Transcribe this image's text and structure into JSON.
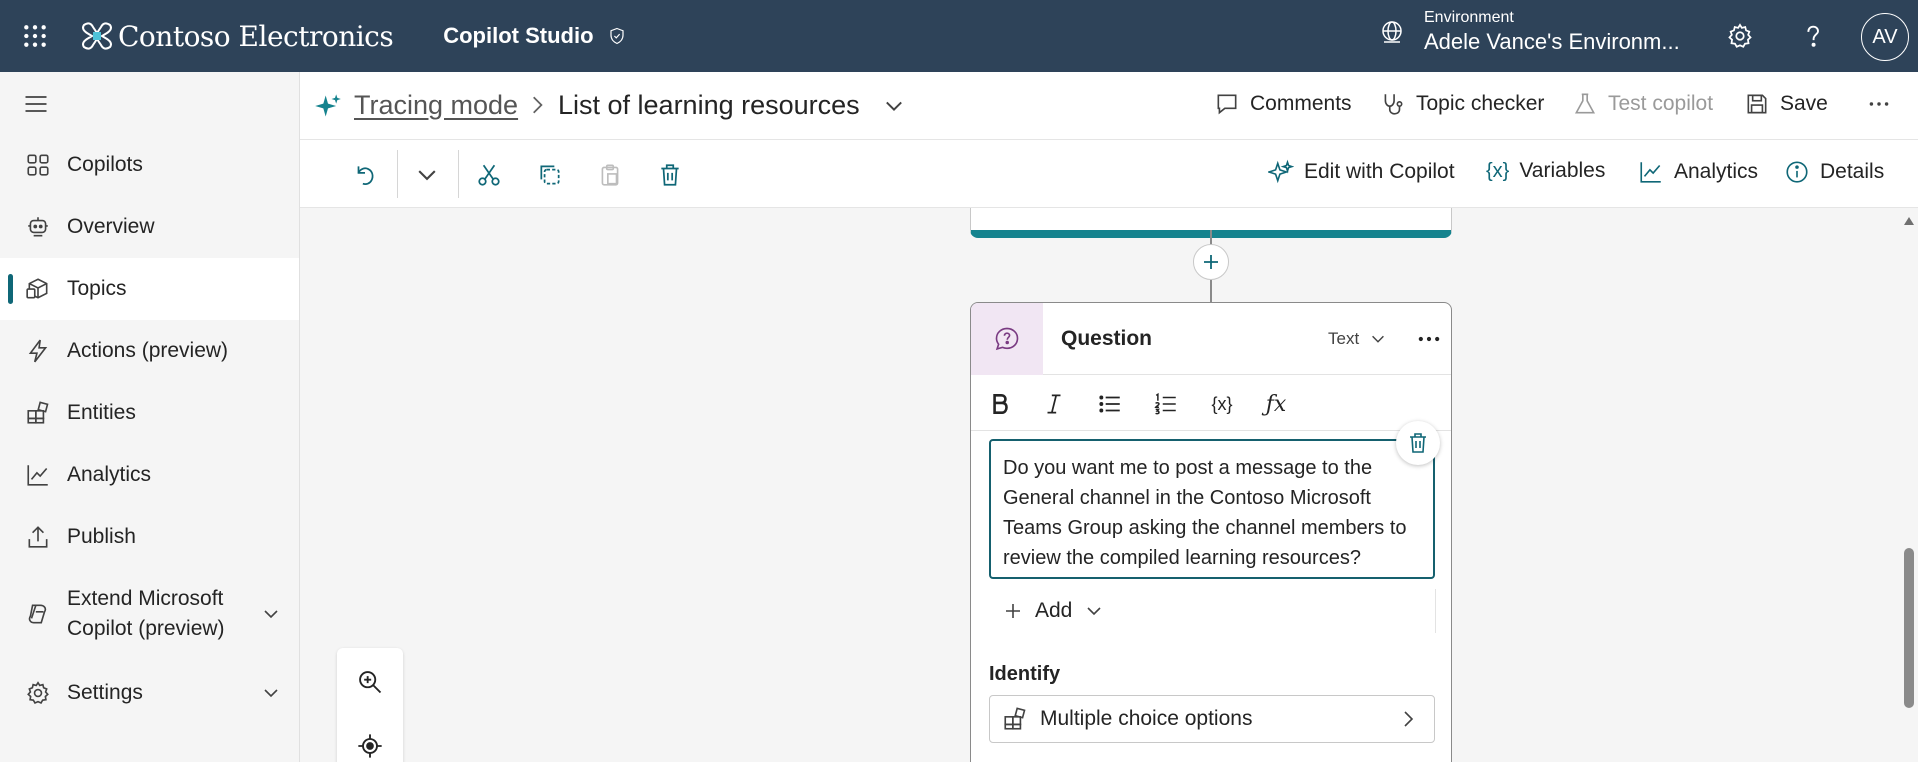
{
  "topbar": {
    "brand": "Contoso Electronics",
    "product": "Copilot Studio",
    "environment_label": "Environment",
    "environment_value": "Adele Vance's Environm...",
    "avatar_initials": "AV"
  },
  "sidebar": {
    "items": [
      {
        "label": "Copilots",
        "icon": "copilots-icon"
      },
      {
        "label": "Overview",
        "icon": "overview-icon"
      },
      {
        "label": "Topics",
        "icon": "topics-icon",
        "active": true
      },
      {
        "label": "Actions (preview)",
        "icon": "lightning-icon"
      },
      {
        "label": "Entities",
        "icon": "entities-icon"
      },
      {
        "label": "Analytics",
        "icon": "analytics-icon"
      },
      {
        "label": "Publish",
        "icon": "publish-icon"
      },
      {
        "label_line1": "Extend Microsoft",
        "label_line2": "Copilot (preview)",
        "icon": "extend-icon"
      },
      {
        "label": "Settings",
        "icon": "gear-icon"
      }
    ]
  },
  "header": {
    "tracing": "Tracing mode",
    "topic": "List of learning resources",
    "comments": "Comments",
    "topic_checker": "Topic checker",
    "test_copilot": "Test copilot",
    "save": "Save"
  },
  "toolbar": {
    "edit_with_copilot": "Edit with Copilot",
    "variables": "Variables",
    "analytics": "Analytics",
    "details": "Details"
  },
  "question_node": {
    "title": "Question",
    "type": "Text",
    "message": "Do you want me to post a message to the General channel in the Contoso Microsoft Teams Group asking the channel members to review the compiled learning resources?",
    "add_label": "Add",
    "identify_label": "Identify",
    "identify_value": "Multiple choice options"
  },
  "colors": {
    "topbar_bg": "#2e4359",
    "accent_teal": "#0f6777",
    "node_border_teal": "#15838e",
    "question_icon_bg": "#f1e6f3"
  }
}
